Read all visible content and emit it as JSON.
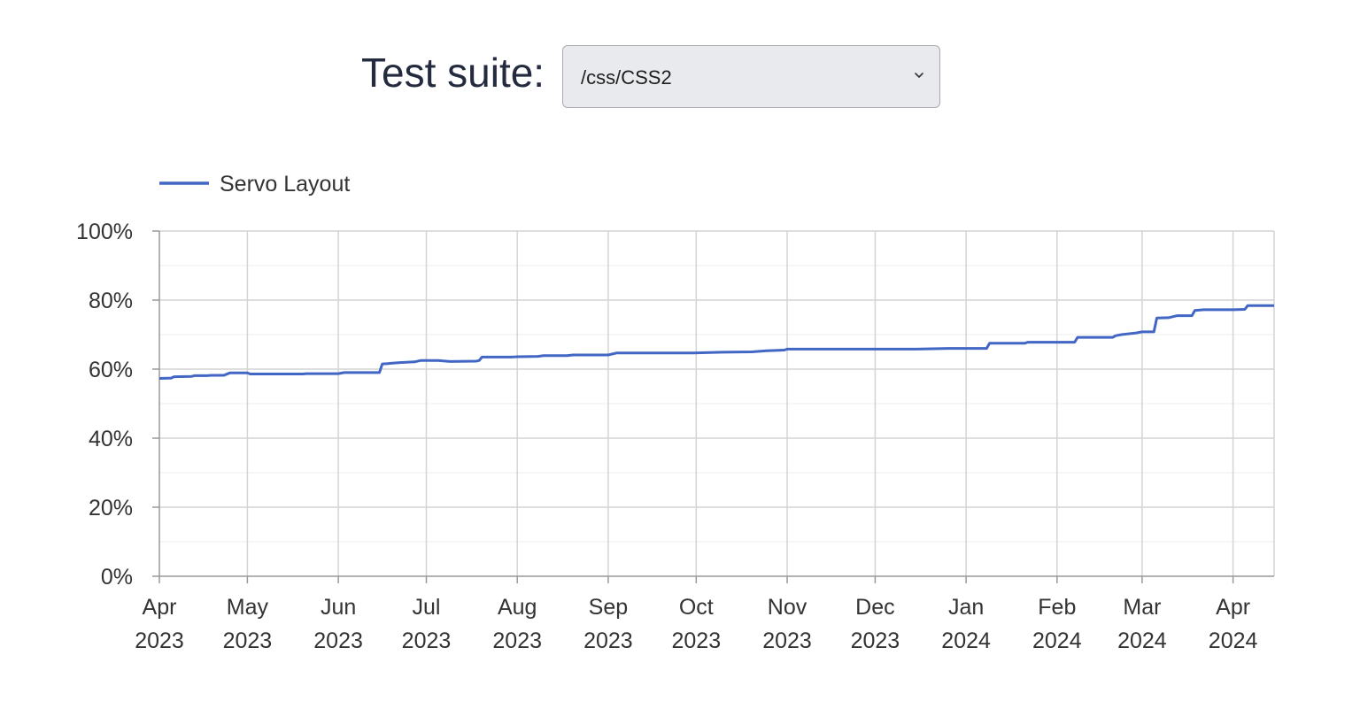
{
  "selector": {
    "label": "Test suite:",
    "selected_value": "/css/CSS2",
    "chevron_icon": "chevron-down-icon"
  },
  "chart_data": {
    "type": "line",
    "series": [
      {
        "name": "Servo Layout",
        "color": "#4166c4",
        "points": [
          [
            "2023-04-01",
            57.3
          ],
          [
            "2023-04-05",
            57.4
          ],
          [
            "2023-04-06",
            57.8
          ],
          [
            "2023-04-12",
            57.9
          ],
          [
            "2023-04-13",
            58.1
          ],
          [
            "2023-04-17",
            58.1
          ],
          [
            "2023-04-19",
            58.2
          ],
          [
            "2023-04-23",
            58.2
          ],
          [
            "2023-04-25",
            58.9
          ],
          [
            "2023-05-01",
            58.9
          ],
          [
            "2023-05-02",
            58.6
          ],
          [
            "2023-05-20",
            58.6
          ],
          [
            "2023-05-21",
            58.7
          ],
          [
            "2023-06-01",
            58.7
          ],
          [
            "2023-06-03",
            59.0
          ],
          [
            "2023-06-15",
            59.0
          ],
          [
            "2023-06-16",
            61.5
          ],
          [
            "2023-06-18",
            61.6
          ],
          [
            "2023-06-19",
            61.7
          ],
          [
            "2023-06-22",
            61.9
          ],
          [
            "2023-06-27",
            62.1
          ],
          [
            "2023-06-29",
            62.5
          ],
          [
            "2023-07-05",
            62.5
          ],
          [
            "2023-07-09",
            62.2
          ],
          [
            "2023-07-18",
            62.3
          ],
          [
            "2023-07-19",
            62.5
          ],
          [
            "2023-07-20",
            63.5
          ],
          [
            "2023-07-30",
            63.5
          ],
          [
            "2023-08-01",
            63.6
          ],
          [
            "2023-08-08",
            63.7
          ],
          [
            "2023-08-10",
            63.9
          ],
          [
            "2023-08-18",
            63.9
          ],
          [
            "2023-08-20",
            64.1
          ],
          [
            "2023-09-01",
            64.1
          ],
          [
            "2023-09-04",
            64.7
          ],
          [
            "2023-09-30",
            64.7
          ],
          [
            "2023-10-10",
            64.9
          ],
          [
            "2023-10-20",
            65.0
          ],
          [
            "2023-10-25",
            65.3
          ],
          [
            "2023-10-31",
            65.5
          ],
          [
            "2023-11-01",
            65.8
          ],
          [
            "2023-12-15",
            65.8
          ],
          [
            "2023-12-26",
            66.0
          ],
          [
            "2024-01-08",
            66.0
          ],
          [
            "2024-01-09",
            67.5
          ],
          [
            "2024-01-21",
            67.5
          ],
          [
            "2024-01-22",
            67.8
          ],
          [
            "2024-02-07",
            67.8
          ],
          [
            "2024-02-08",
            69.2
          ],
          [
            "2024-02-20",
            69.2
          ],
          [
            "2024-02-21",
            69.7
          ],
          [
            "2024-02-23",
            70.0
          ],
          [
            "2024-02-28",
            70.5
          ],
          [
            "2024-03-01",
            70.8
          ],
          [
            "2024-03-05",
            70.8
          ],
          [
            "2024-03-06",
            74.8
          ],
          [
            "2024-03-10",
            74.9
          ],
          [
            "2024-03-13",
            75.5
          ],
          [
            "2024-03-18",
            75.5
          ],
          [
            "2024-03-19",
            77.0
          ],
          [
            "2024-03-22",
            77.2
          ],
          [
            "2024-04-01",
            77.2
          ],
          [
            "2024-04-05",
            77.3
          ],
          [
            "2024-04-06",
            78.4
          ],
          [
            "2024-04-15",
            78.4
          ]
        ]
      }
    ],
    "x_ticks": [
      [
        "2023-04-01",
        "Apr",
        "2023"
      ],
      [
        "2023-05-01",
        "May",
        "2023"
      ],
      [
        "2023-06-01",
        "Jun",
        "2023"
      ],
      [
        "2023-07-01",
        "Jul",
        "2023"
      ],
      [
        "2023-08-01",
        "Aug",
        "2023"
      ],
      [
        "2023-09-01",
        "Sep",
        "2023"
      ],
      [
        "2023-10-01",
        "Oct",
        "2023"
      ],
      [
        "2023-11-01",
        "Nov",
        "2023"
      ],
      [
        "2023-12-01",
        "Dec",
        "2023"
      ],
      [
        "2024-01-01",
        "Jan",
        "2024"
      ],
      [
        "2024-02-01",
        "Feb",
        "2024"
      ],
      [
        "2024-03-01",
        "Mar",
        "2024"
      ],
      [
        "2024-04-01",
        "Apr",
        "2024"
      ]
    ],
    "xlim": [
      "2023-04-01",
      "2024-04-15"
    ],
    "y_ticks": [
      "0%",
      "20%",
      "40%",
      "60%",
      "80%",
      "100%"
    ],
    "ylim": [
      0,
      100
    ],
    "ytick_values": [
      0,
      20,
      40,
      60,
      80,
      100
    ],
    "grid": true,
    "legend_position": "top-left"
  }
}
